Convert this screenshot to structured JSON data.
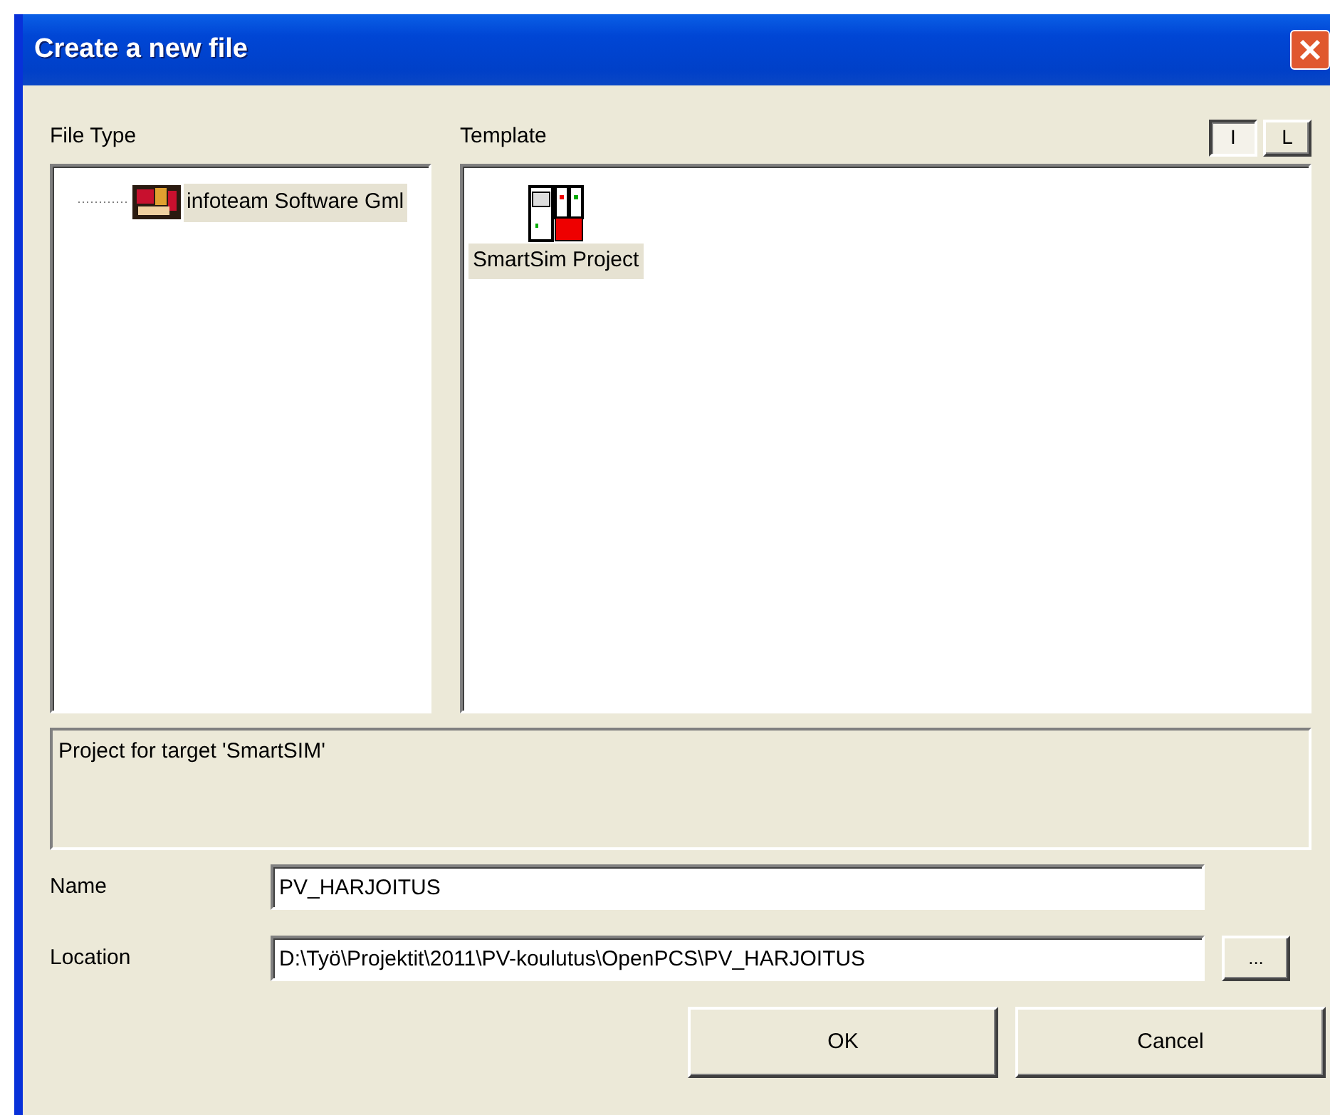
{
  "window": {
    "title": "Create a new file"
  },
  "file_type": {
    "label": "File Type",
    "items": [
      {
        "label": "infoteam Software Gml",
        "selected": true
      }
    ]
  },
  "template": {
    "label": "Template",
    "view_buttons": [
      {
        "label": "I",
        "selected": true
      },
      {
        "label": "L",
        "selected": false
      }
    ],
    "items": [
      {
        "label": "SmartSim Project",
        "selected": true
      }
    ]
  },
  "description": "Project for target 'SmartSIM'",
  "name": {
    "label": "Name",
    "value": "PV_HARJOITUS"
  },
  "location": {
    "label": "Location",
    "value": "D:\\Työ\\Projektit\\2011\\PV-koulutus\\OpenPCS\\PV_HARJOITUS",
    "browse": "..."
  },
  "buttons": [
    "OK",
    "Cancel"
  ]
}
